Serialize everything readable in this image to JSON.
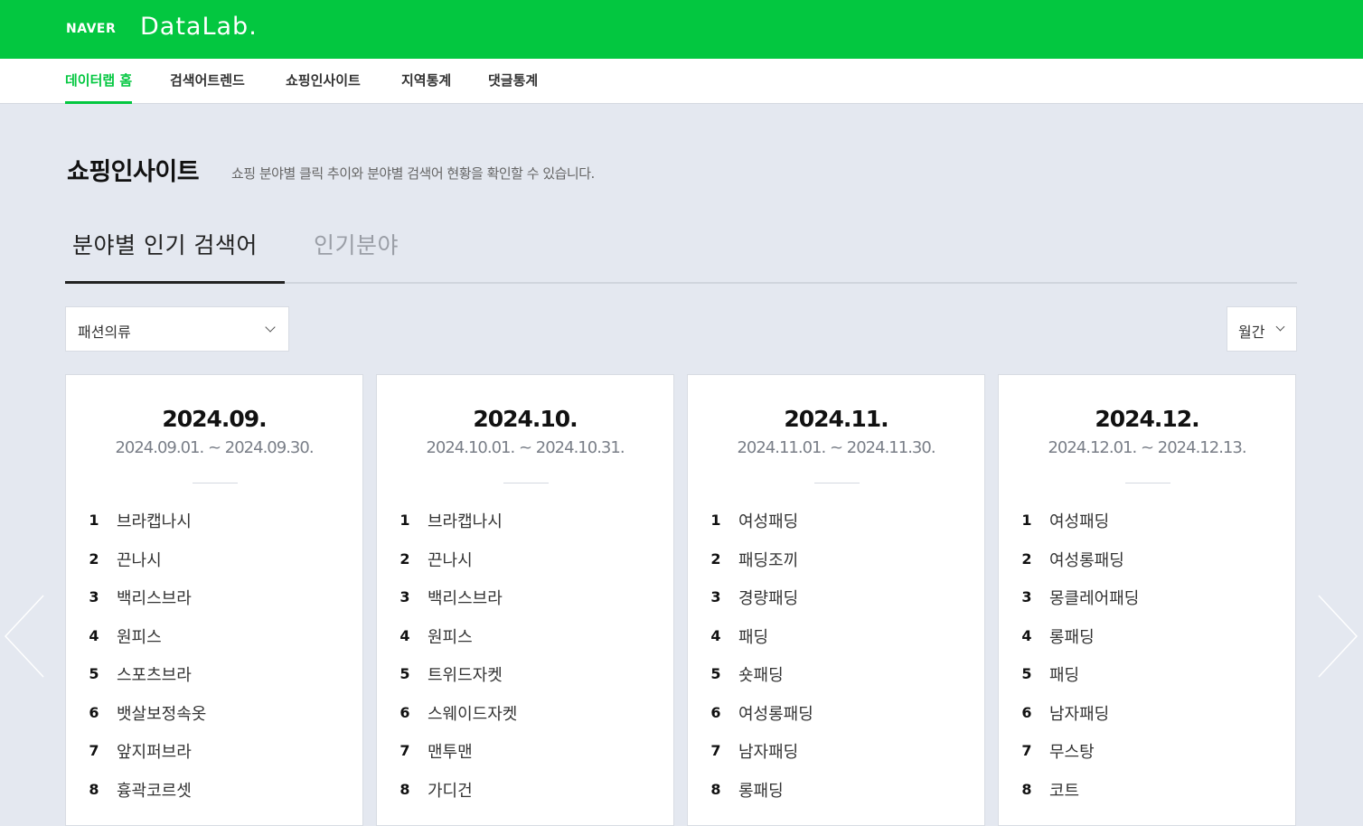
{
  "header": {
    "brand": "NAVER",
    "product": "DataLab."
  },
  "gnb": {
    "items": [
      {
        "label": "데이터랩 홈",
        "active": true
      },
      {
        "label": "검색어트렌드",
        "active": false
      },
      {
        "label": "쇼핑인사이트",
        "active": false
      },
      {
        "label": "지역통계",
        "active": false
      },
      {
        "label": "댓글통계",
        "active": false
      }
    ]
  },
  "page": {
    "title": "쇼핑인사이트",
    "description": "쇼핑 분야별 클릭 추이와 분야별 검색어 현황을 확인할 수 있습니다."
  },
  "tabs": [
    {
      "label": "분야별 인기 검색어",
      "active": true
    },
    {
      "label": "인기분야",
      "active": false
    }
  ],
  "filters": {
    "category": "패션의류",
    "period": "월간"
  },
  "cards": [
    {
      "month": "2024.09.",
      "range": "2024.09.01. ~ 2024.09.30.",
      "ranks": [
        {
          "n": "1",
          "kw": "브라캡나시"
        },
        {
          "n": "2",
          "kw": "끈나시"
        },
        {
          "n": "3",
          "kw": "백리스브라"
        },
        {
          "n": "4",
          "kw": "원피스"
        },
        {
          "n": "5",
          "kw": "스포츠브라"
        },
        {
          "n": "6",
          "kw": "뱃살보정속옷"
        },
        {
          "n": "7",
          "kw": "앞지퍼브라"
        },
        {
          "n": "8",
          "kw": "흉곽코르셋"
        }
      ]
    },
    {
      "month": "2024.10.",
      "range": "2024.10.01. ~ 2024.10.31.",
      "ranks": [
        {
          "n": "1",
          "kw": "브라캡나시"
        },
        {
          "n": "2",
          "kw": "끈나시"
        },
        {
          "n": "3",
          "kw": "백리스브라"
        },
        {
          "n": "4",
          "kw": "원피스"
        },
        {
          "n": "5",
          "kw": "트위드자켓"
        },
        {
          "n": "6",
          "kw": "스웨이드자켓"
        },
        {
          "n": "7",
          "kw": "맨투맨"
        },
        {
          "n": "8",
          "kw": "가디건"
        }
      ]
    },
    {
      "month": "2024.11.",
      "range": "2024.11.01. ~ 2024.11.30.",
      "ranks": [
        {
          "n": "1",
          "kw": "여성패딩"
        },
        {
          "n": "2",
          "kw": "패딩조끼"
        },
        {
          "n": "3",
          "kw": "경량패딩"
        },
        {
          "n": "4",
          "kw": "패딩"
        },
        {
          "n": "5",
          "kw": "숏패딩"
        },
        {
          "n": "6",
          "kw": "여성롱패딩"
        },
        {
          "n": "7",
          "kw": "남자패딩"
        },
        {
          "n": "8",
          "kw": "롱패딩"
        }
      ]
    },
    {
      "month": "2024.12.",
      "range": "2024.12.01. ~ 2024.12.13.",
      "ranks": [
        {
          "n": "1",
          "kw": "여성패딩"
        },
        {
          "n": "2",
          "kw": "여성롱패딩"
        },
        {
          "n": "3",
          "kw": "몽클레어패딩"
        },
        {
          "n": "4",
          "kw": "롱패딩"
        },
        {
          "n": "5",
          "kw": "패딩"
        },
        {
          "n": "6",
          "kw": "남자패딩"
        },
        {
          "n": "7",
          "kw": "무스탕"
        },
        {
          "n": "8",
          "kw": "코트"
        }
      ]
    }
  ],
  "colors": {
    "brand_green": "#03c740",
    "page_bg": "#e4e8f0"
  },
  "icons": {
    "prev": "chevron-left-icon",
    "next": "chevron-right-icon",
    "dropdown": "chevron-down-icon"
  }
}
